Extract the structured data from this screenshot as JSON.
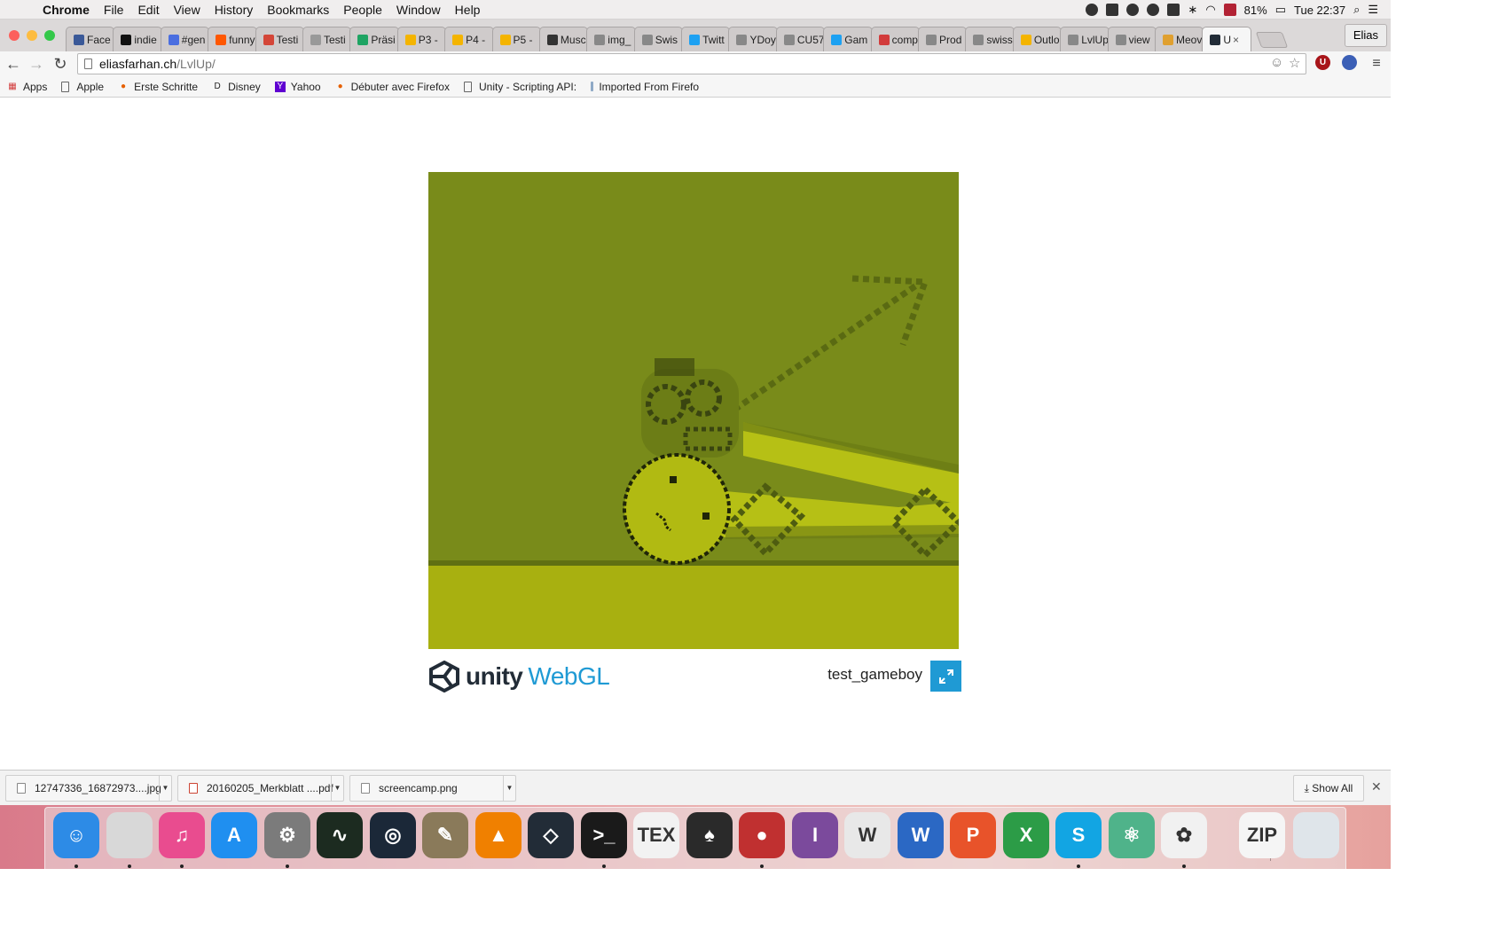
{
  "menubar": {
    "app": "Chrome",
    "items": [
      "File",
      "Edit",
      "View",
      "History",
      "Bookmarks",
      "People",
      "Window",
      "Help"
    ],
    "battery": "81%",
    "clock": "Tue 22:37"
  },
  "tabs": [
    {
      "label": "Face",
      "icon": "facebook-icon",
      "color": "#3b5998"
    },
    {
      "label": "indie",
      "icon": "kickstarter-icon",
      "color": "#111111"
    },
    {
      "label": "#gen",
      "icon": "generic-app-icon",
      "color": "#4a6ee0"
    },
    {
      "label": "funny",
      "icon": "reddit-icon",
      "color": "#ff5700"
    },
    {
      "label": "Testi",
      "icon": "gmail-icon",
      "color": "#d44638"
    },
    {
      "label": "Testi",
      "icon": "apple-icon",
      "color": "#999999"
    },
    {
      "label": "Präsi",
      "icon": "drive-icon",
      "color": "#1fa463"
    },
    {
      "label": "P3 -",
      "icon": "slides-icon",
      "color": "#f4b400"
    },
    {
      "label": "P4 -",
      "icon": "slides-icon",
      "color": "#f4b400"
    },
    {
      "label": "P5 -",
      "icon": "slides-icon",
      "color": "#f4b400"
    },
    {
      "label": "Musc",
      "icon": "circle-icon",
      "color": "#333333"
    },
    {
      "label": "img_",
      "icon": "page-icon",
      "color": "#888888"
    },
    {
      "label": "Swis",
      "icon": "page-icon",
      "color": "#888888"
    },
    {
      "label": "Twitt",
      "icon": "twitter-icon",
      "color": "#1da1f2"
    },
    {
      "label": "YDoy",
      "icon": "page-icon",
      "color": "#888888"
    },
    {
      "label": "CU57",
      "icon": "page-icon",
      "color": "#888888"
    },
    {
      "label": "Gam",
      "icon": "twitter-icon",
      "color": "#1da1f2"
    },
    {
      "label": "comp",
      "icon": "colorful-icon",
      "color": "#d23b3b"
    },
    {
      "label": "Prod",
      "icon": "page-icon",
      "color": "#888888"
    },
    {
      "label": "swiss",
      "icon": "page-icon",
      "color": "#888888"
    },
    {
      "label": "Outlo",
      "icon": "outlook-icon",
      "color": "#f4b400"
    },
    {
      "label": "LvlUp",
      "icon": "page-icon",
      "color": "#888888"
    },
    {
      "label": "view",
      "icon": "page-icon",
      "color": "#888888"
    },
    {
      "label": "Meov",
      "icon": "image-icon",
      "color": "#e0a030"
    },
    {
      "label": "U",
      "icon": "unity-icon",
      "color": "#222c37",
      "active": true
    }
  ],
  "profile": "Elias",
  "address": {
    "host": "eliasfarhan.ch",
    "path": "/LvlUp/"
  },
  "bookmarks": [
    {
      "label": "Apps",
      "icon": "apps-grid-icon"
    },
    {
      "label": "Apple",
      "icon": "page-icon"
    },
    {
      "label": "Erste Schritte",
      "icon": "firefox-icon"
    },
    {
      "label": "Disney",
      "icon": "disney-icon"
    },
    {
      "label": "Yahoo",
      "icon": "yahoo-icon"
    },
    {
      "label": "Débuter avec Firefox",
      "icon": "firefox-icon"
    },
    {
      "label": "Unity - Scripting API:",
      "icon": "page-icon"
    },
    {
      "label": "Imported From Firefo",
      "icon": "folder-icon"
    }
  ],
  "player": {
    "brand": "unity",
    "product": "WebGL",
    "title": "test_gameboy"
  },
  "downloads": [
    {
      "name": "12747336_16872973....jpg",
      "icon": "image-file-icon"
    },
    {
      "name": "20160205_Merkblatt ....pdf",
      "icon": "pdf-file-icon"
    },
    {
      "name": "screencamp.png",
      "icon": "image-file-icon"
    }
  ],
  "show_all": "Show All",
  "dock": [
    {
      "name": "finder-icon",
      "glyph": "☺",
      "color": "#2d8be6",
      "running": true
    },
    {
      "name": "chrome-icon",
      "glyph": "",
      "color": "#d8d8d8",
      "running": true
    },
    {
      "name": "itunes-icon",
      "glyph": "♫",
      "color": "#e94c8f",
      "running": true
    },
    {
      "name": "app-store-icon",
      "glyph": "A",
      "color": "#1f8ff0",
      "running": false
    },
    {
      "name": "system-preferences-icon",
      "glyph": "⚙",
      "color": "#7b7b7b",
      "running": true
    },
    {
      "name": "activity-monitor-icon",
      "glyph": "∿",
      "color": "#1c2b20",
      "running": false
    },
    {
      "name": "steam-icon",
      "glyph": "◎",
      "color": "#1b2838",
      "running": false
    },
    {
      "name": "gimp-icon",
      "glyph": "✎",
      "color": "#8a7a5a",
      "running": false
    },
    {
      "name": "vlc-icon",
      "glyph": "▲",
      "color": "#f08000",
      "running": false
    },
    {
      "name": "unity-icon",
      "glyph": "◇",
      "color": "#222c37",
      "running": false
    },
    {
      "name": "terminal-icon",
      "glyph": ">_",
      "color": "#1a1a1a",
      "running": true
    },
    {
      "name": "tex-icon",
      "glyph": "TEX",
      "color": "#f2f2f2",
      "running": false
    },
    {
      "name": "spades-icon",
      "glyph": "♠",
      "color": "#2a2a2a",
      "running": false
    },
    {
      "name": "joystick-icon",
      "glyph": "●",
      "color": "#c03030",
      "running": true
    },
    {
      "name": "tor-icon",
      "glyph": "I",
      "color": "#7b4a9c",
      "running": false
    },
    {
      "name": "wikipedia-icon",
      "glyph": "W",
      "color": "#e8e8e8",
      "running": false
    },
    {
      "name": "word-icon",
      "glyph": "W",
      "color": "#2b68c4",
      "running": false
    },
    {
      "name": "powerpoint-icon",
      "glyph": "P",
      "color": "#e8532a",
      "running": false
    },
    {
      "name": "excel-icon",
      "glyph": "X",
      "color": "#2c9c47",
      "running": false
    },
    {
      "name": "skype-icon",
      "glyph": "S",
      "color": "#12a5e3",
      "running": true
    },
    {
      "name": "atom-icon",
      "glyph": "⚛",
      "color": "#4fb38a",
      "running": false
    },
    {
      "name": "photos-icon",
      "glyph": "✿",
      "color": "#f1f1f1",
      "running": true
    },
    {
      "name": "zip-icon",
      "glyph": "ZIP",
      "color": "#f5f5f5",
      "running": false
    },
    {
      "name": "trash-icon",
      "glyph": "",
      "color": "#dfe5ea",
      "running": false
    }
  ]
}
